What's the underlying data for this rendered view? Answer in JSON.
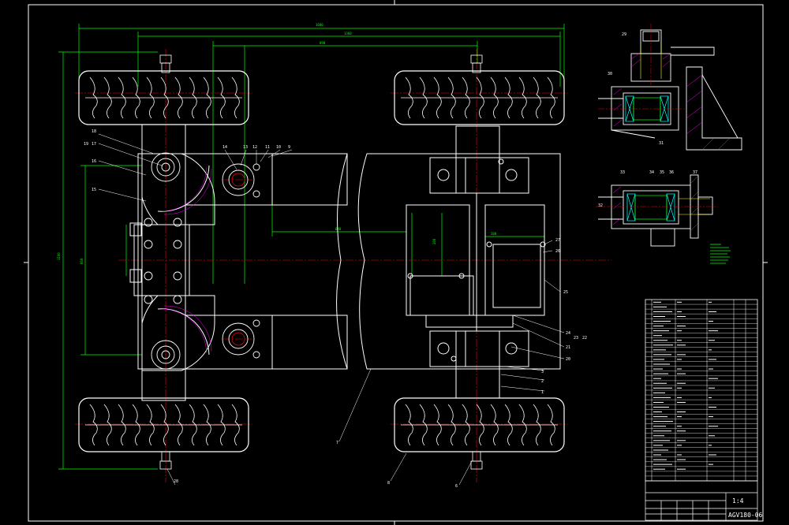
{
  "title_block": {
    "scale": "1:4",
    "drawing_number": "AGV180-06"
  },
  "colors": {
    "background": "#000000",
    "outline": "#ffffff",
    "dimension": "#00ff00",
    "centerline": "#ff0000",
    "hatch": "#ff00ff",
    "bearing": "#00ffff",
    "thread": "#ffff00"
  }
}
